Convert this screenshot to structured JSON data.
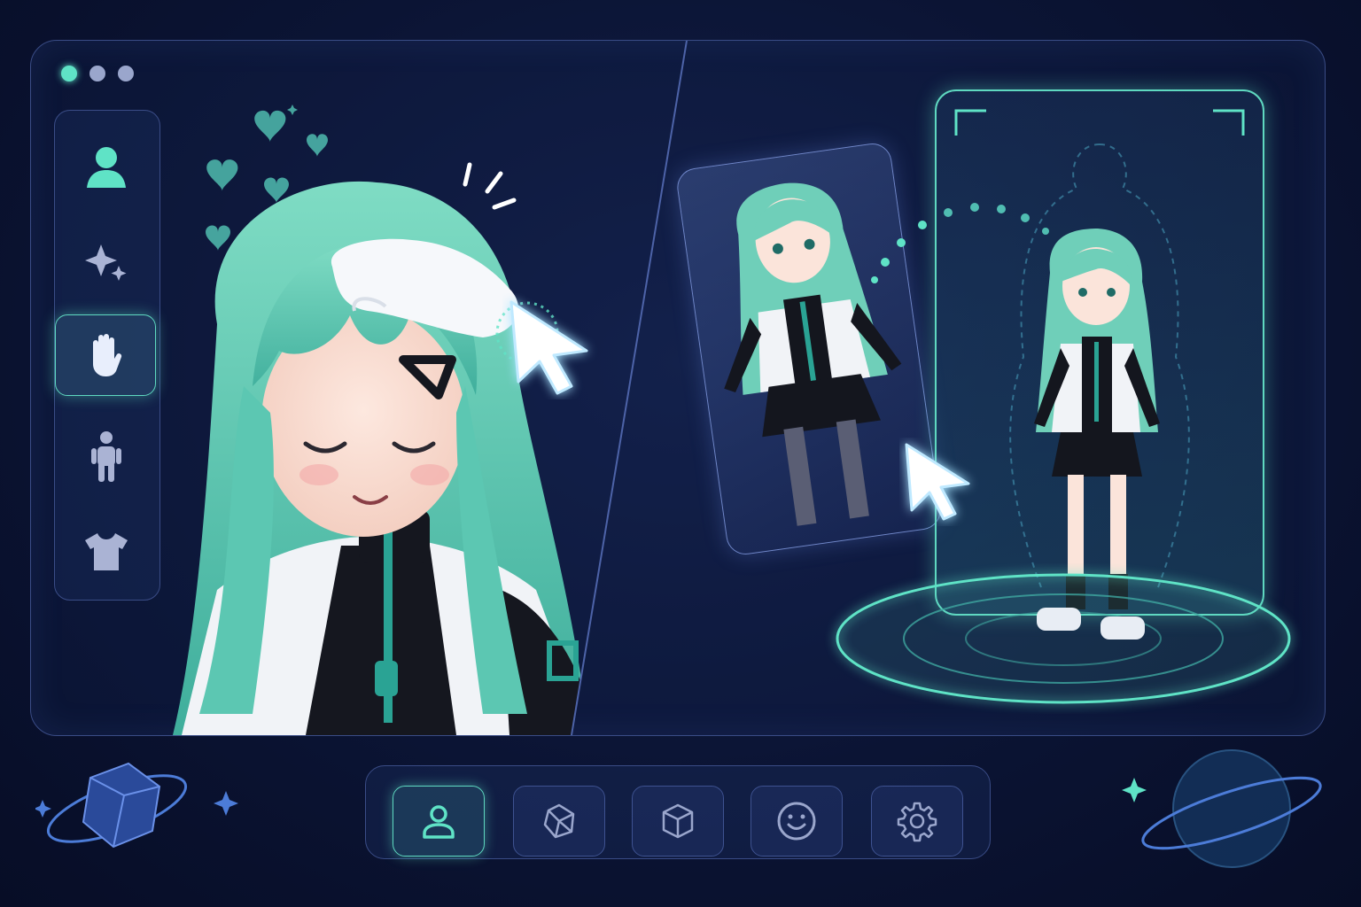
{
  "window": {
    "controls": [
      "dot-1",
      "dot-2",
      "dot-3"
    ]
  },
  "sidebar": {
    "items": [
      {
        "icon": "user-icon",
        "active": false
      },
      {
        "icon": "sparkles-icon",
        "active": false
      },
      {
        "icon": "hand-icon",
        "active": true
      },
      {
        "icon": "body-icon",
        "active": false
      },
      {
        "icon": "shirt-icon",
        "active": false
      }
    ]
  },
  "toolbar": {
    "items": [
      {
        "icon": "user-icon",
        "active": true
      },
      {
        "icon": "model-icon",
        "active": false
      },
      {
        "icon": "cube-icon",
        "active": false
      },
      {
        "icon": "smile-icon",
        "active": false
      },
      {
        "icon": "gear-icon",
        "active": false
      }
    ]
  },
  "colors": {
    "accent": "#5fe3c6",
    "background": "#0b1434",
    "border": "#3a4c86",
    "icon_inactive": "#9aa6cc"
  }
}
